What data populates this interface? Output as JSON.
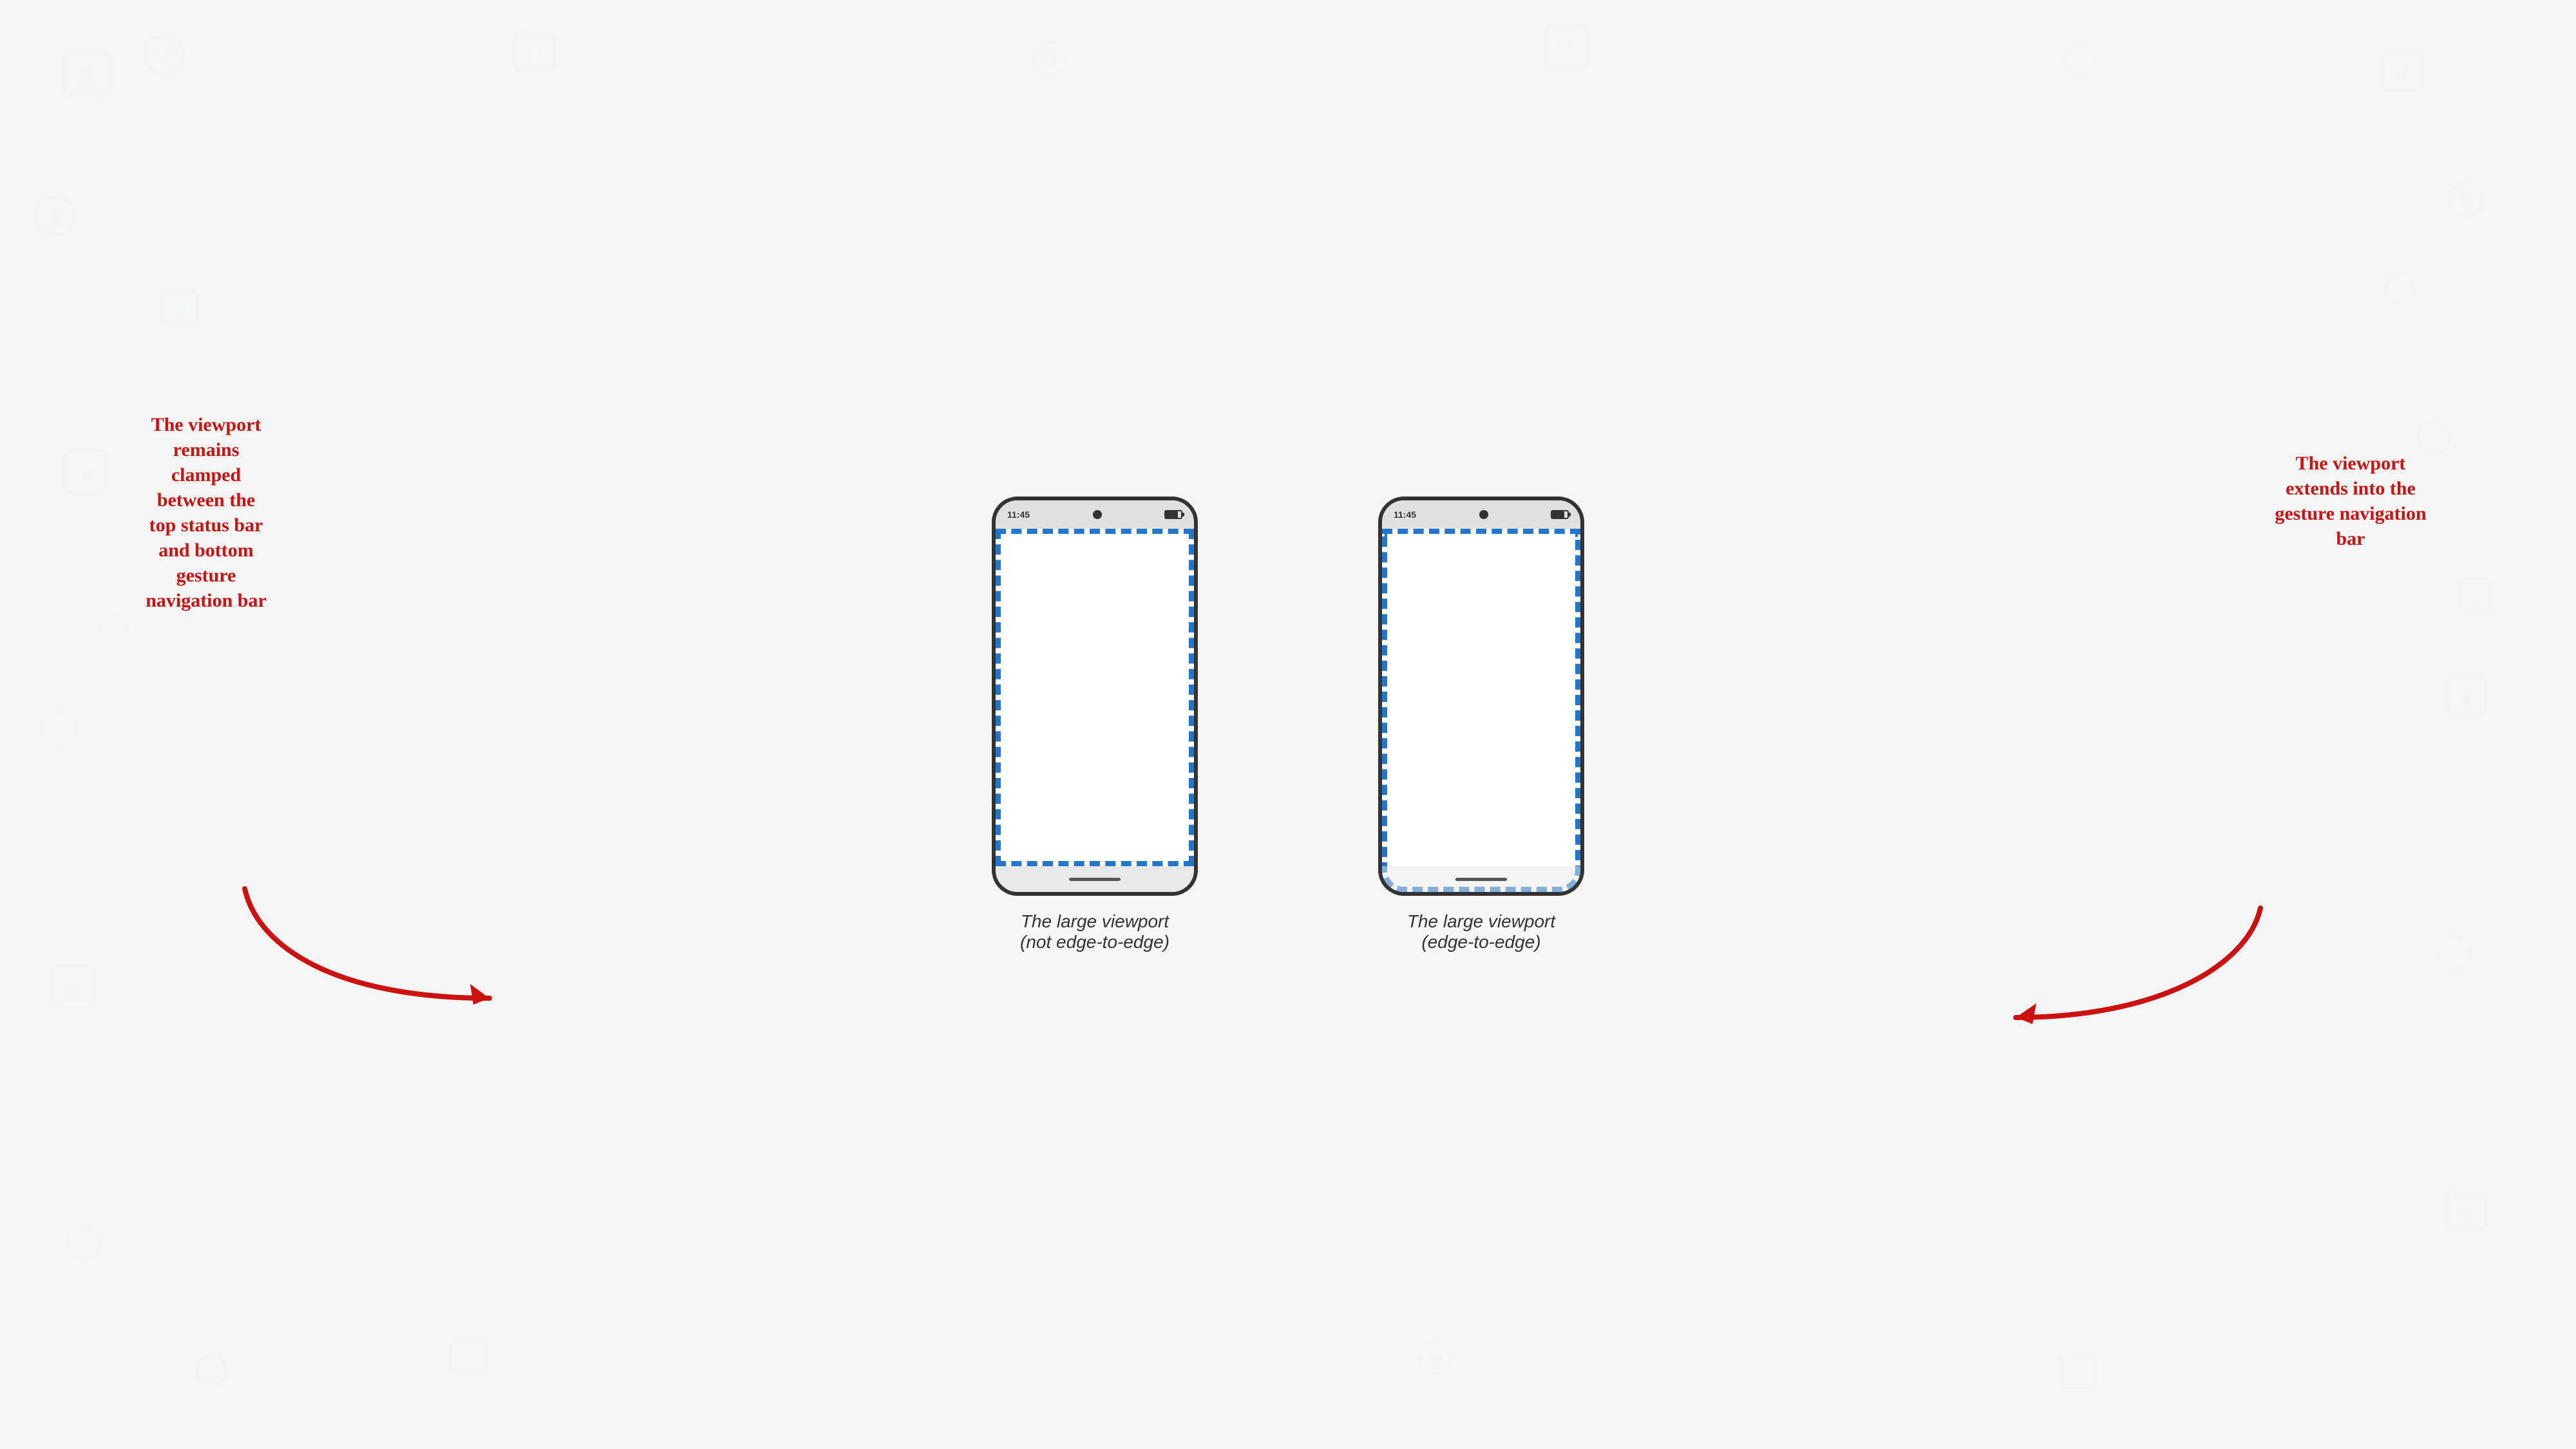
{
  "page": {
    "background_color": "#f5f5f5"
  },
  "phones": [
    {
      "id": "not-edge",
      "status_time": "11:45",
      "caption_line1": "The large viewport",
      "caption_line2": "(not edge-to-edge)",
      "viewport_type": "clamped"
    },
    {
      "id": "edge",
      "status_time": "11:45",
      "caption_line1": "The large viewport",
      "caption_line2": "(edge-to-edge)",
      "viewport_type": "extended"
    }
  ],
  "annotations": {
    "left": {
      "line1": "The viewport",
      "line2": "remains",
      "line3": "clamped",
      "line4": "between the",
      "line5": "top status bar",
      "line6": "and bottom",
      "line7": "gesture",
      "line8": "navigation bar"
    },
    "right": {
      "line1": "The viewport",
      "line2": "extends into the",
      "line3": "gesture navigation",
      "line4": "bar"
    }
  },
  "captions": {
    "not_edge_line1": "The large viewport",
    "not_edge_line2": "(not edge-to-edge)",
    "edge_line1": "The large viewport",
    "edge_line2": "(edge-to-edge)"
  }
}
